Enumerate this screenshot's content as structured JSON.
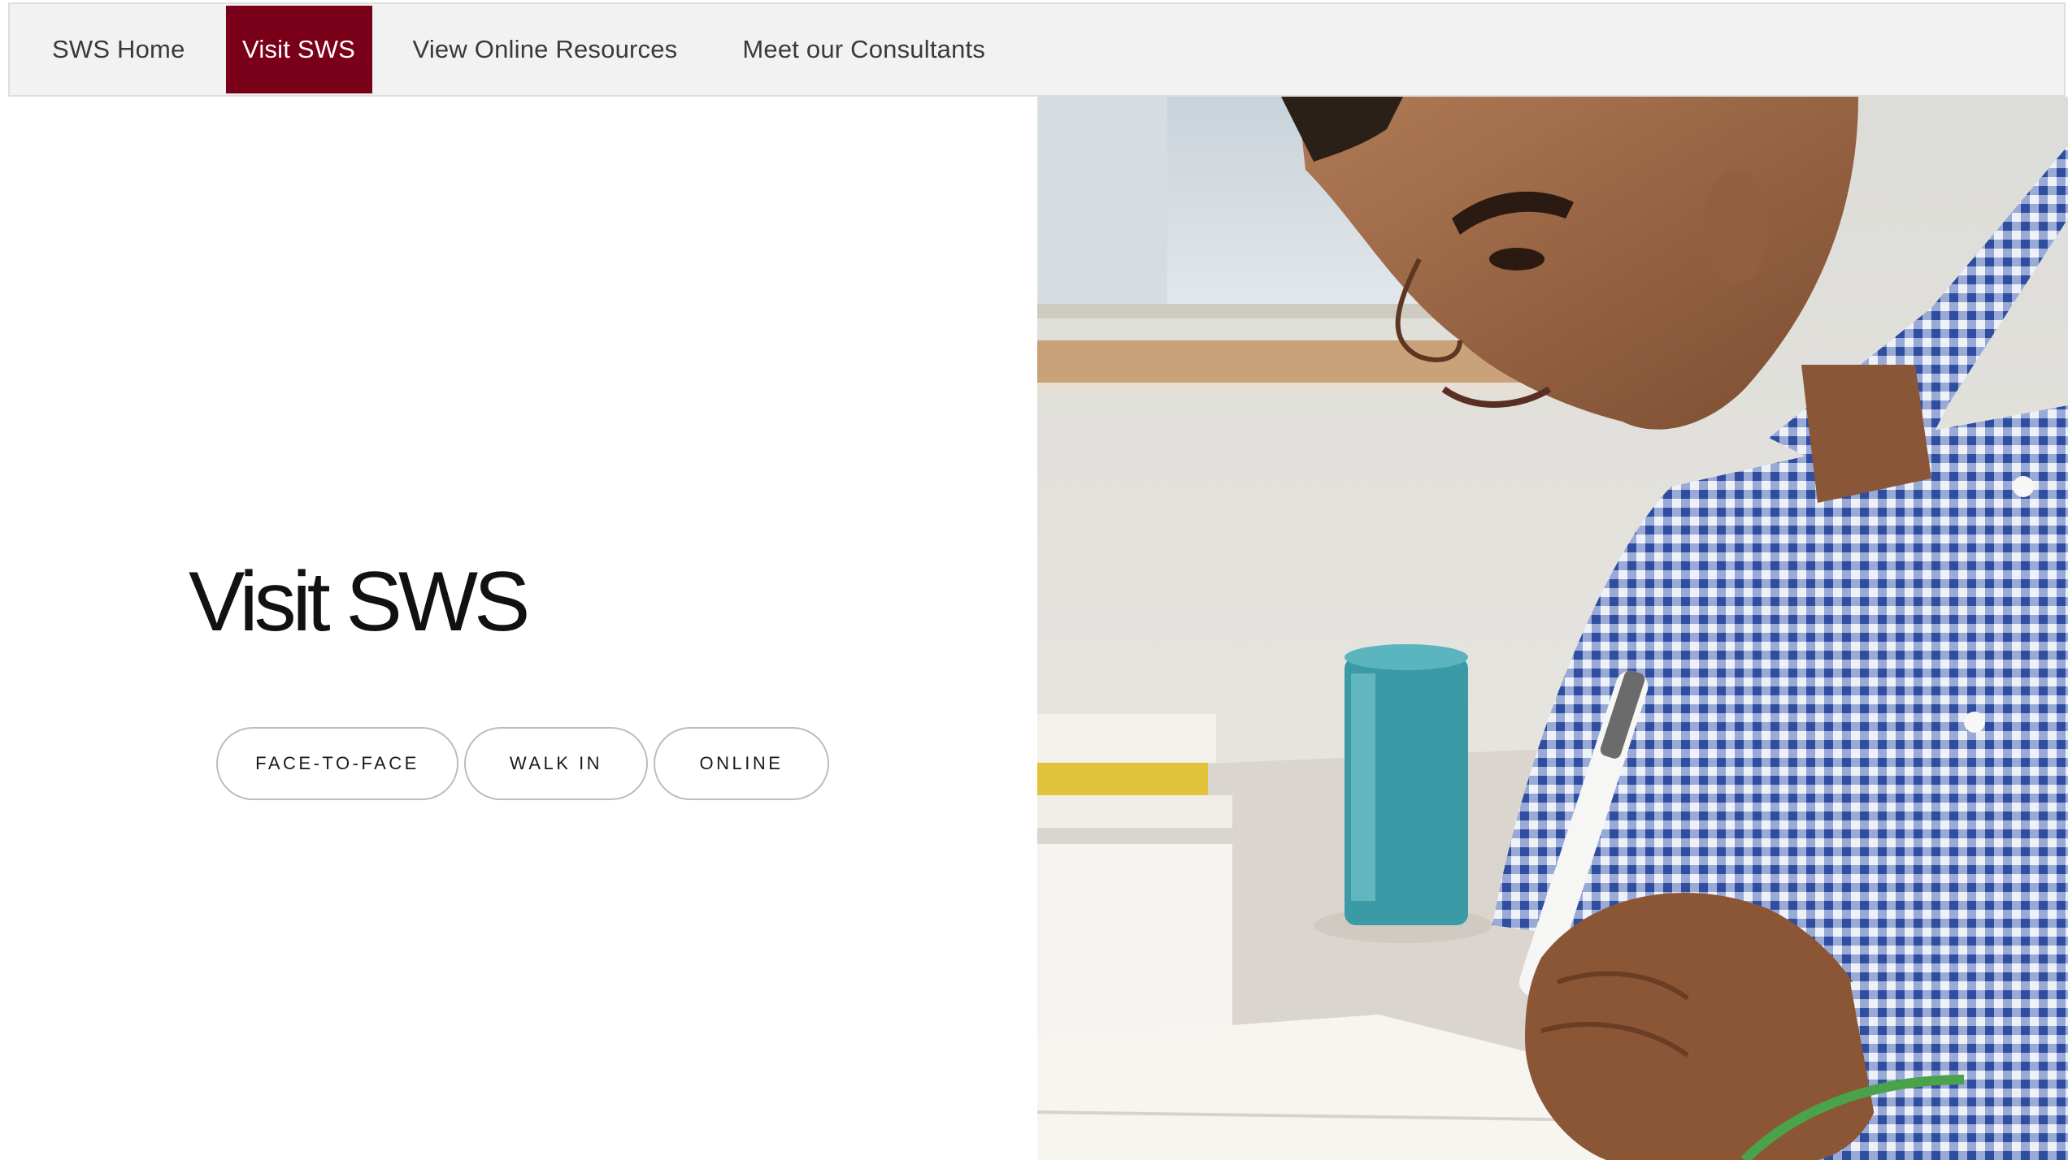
{
  "nav": {
    "items": [
      {
        "label": "SWS Home",
        "active": false
      },
      {
        "label": "Visit SWS",
        "active": true
      },
      {
        "label": "View Online Resources",
        "active": false
      },
      {
        "label": "Meet our Consultants",
        "active": false
      }
    ]
  },
  "hero": {
    "title": "Visit SWS",
    "buttons": [
      {
        "label": "FACE-TO-FACE"
      },
      {
        "label": "WALK IN"
      },
      {
        "label": "ONLINE"
      }
    ]
  },
  "colors": {
    "accent": "#7a0019",
    "nav_background": "#f2f2f2",
    "pill_border": "#bdbdbd"
  }
}
